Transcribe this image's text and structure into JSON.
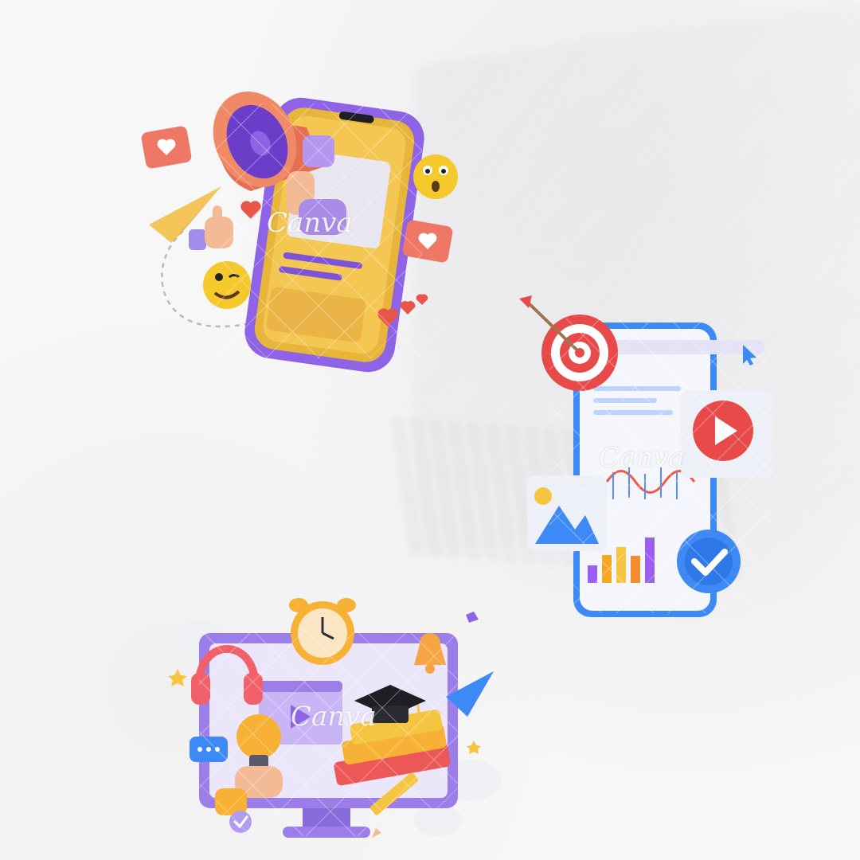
{
  "watermark": {
    "text": "Canva"
  },
  "illustrations": [
    {
      "name": "social-media-marketing-illustration"
    },
    {
      "name": "digital-marketing-analytics-illustration"
    },
    {
      "name": "online-learning-illustration"
    }
  ],
  "colors": {
    "background": "#f7f7f8",
    "purple": "#8b6cf0",
    "yellow": "#f7c54a",
    "orange": "#f2824e",
    "red": "#e8504c",
    "blue": "#3d8af7"
  }
}
